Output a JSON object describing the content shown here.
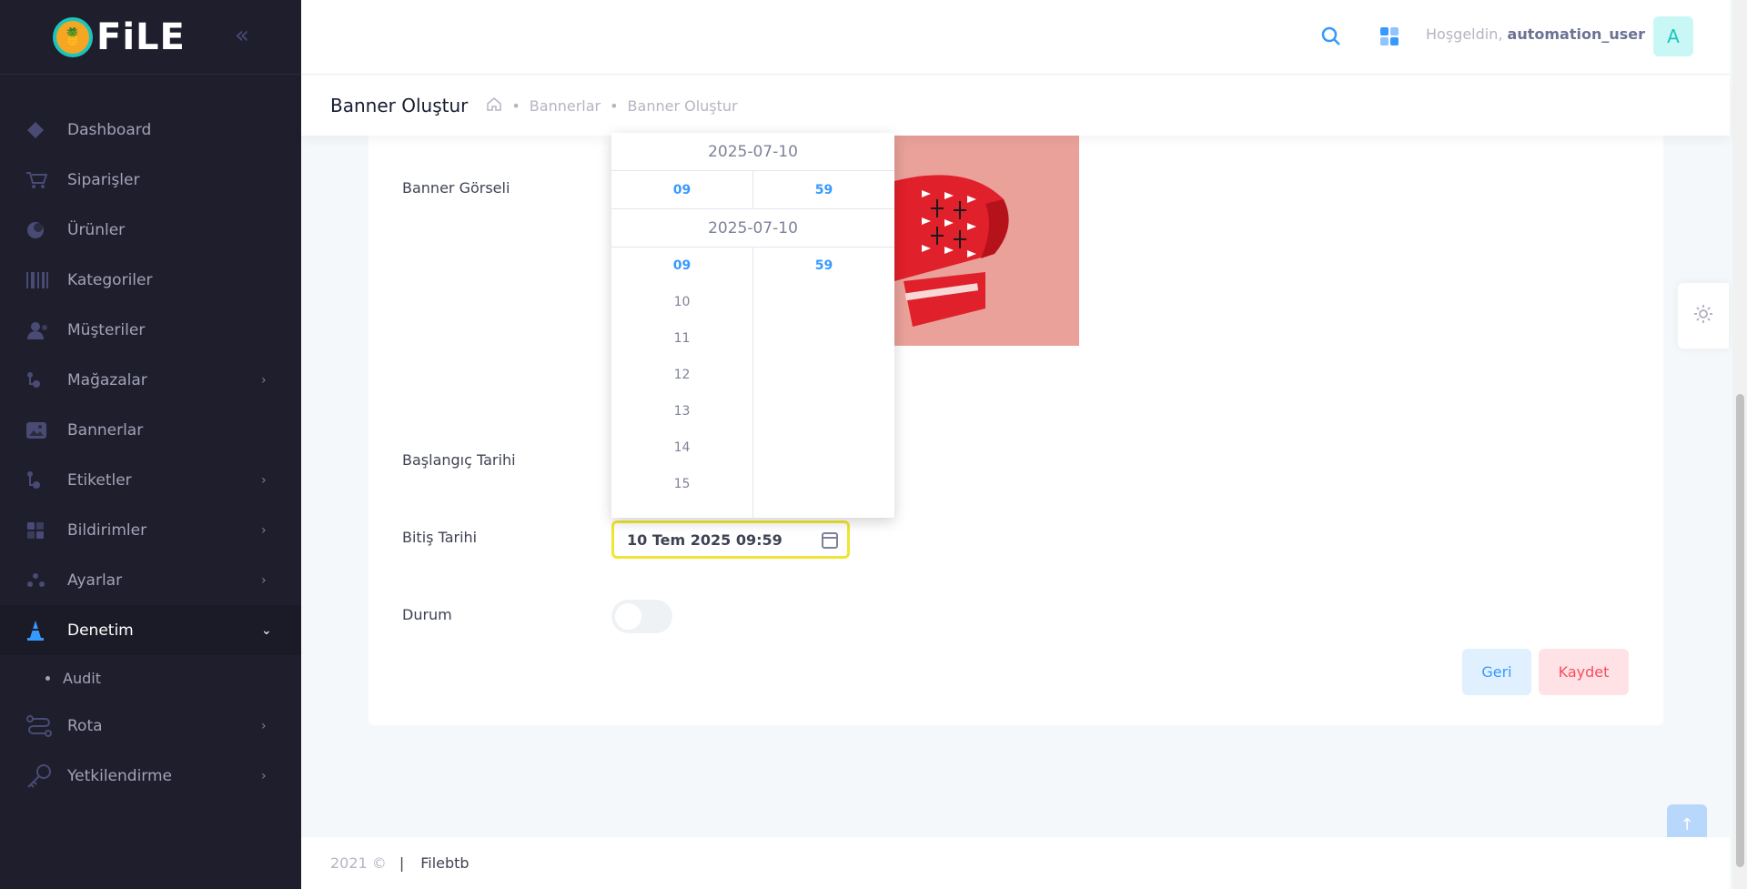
{
  "sidebar": {
    "logo_text": "FiLE",
    "logo_mark": "🍍",
    "collapse_glyph": "«",
    "items": [
      {
        "label": "Dashboard"
      },
      {
        "label": "Siparişler"
      },
      {
        "label": "Ürünler"
      },
      {
        "label": "Kategoriler"
      },
      {
        "label": "Müşteriler"
      },
      {
        "label": "Mağazalar"
      },
      {
        "label": "Bannerlar"
      },
      {
        "label": "Etiketler"
      },
      {
        "label": "Bildirimler"
      },
      {
        "label": "Ayarlar"
      },
      {
        "label": "Denetim"
      },
      {
        "label": "Rota"
      },
      {
        "label": "Yetkilendirme"
      }
    ],
    "sub_items": [
      {
        "label": "Audit"
      }
    ],
    "arrow_right": "›",
    "arrow_down": "⌄"
  },
  "header": {
    "welcome": "Hoşgeldin,",
    "username": "automation_user",
    "avatar_letter": "A"
  },
  "subheader": {
    "title": "Banner Oluştur",
    "breadcrumb_sep": "•",
    "breadcrumbs": [
      "Bannerlar",
      "Banner Oluştur"
    ]
  },
  "form": {
    "banner_label": "Banner Görseli",
    "start_label": "Başlangıç Tarihi",
    "end_label": "Bitiş Tarihi",
    "end_value": "10 Tem 2025 09:59",
    "status_label": "Durum",
    "back_label": "Geri",
    "save_label": "Kaydet"
  },
  "picker": {
    "date_top": "2025-07-10",
    "hour_top": "09",
    "minute_top": "59",
    "date_second": "2025-07-10",
    "hours": [
      "09",
      "10",
      "11",
      "12",
      "13",
      "14",
      "15"
    ],
    "minutes": [
      "59"
    ]
  },
  "footer": {
    "copyright": "2021 ©",
    "divider": "|",
    "brand": "Filebtb"
  },
  "scroll_top_glyph": "↑",
  "colors": {
    "sidebar_bg": "#1e1e2d",
    "accent": "#3699ff",
    "highlight_border": "#f0e532",
    "danger": "#f64e60"
  }
}
